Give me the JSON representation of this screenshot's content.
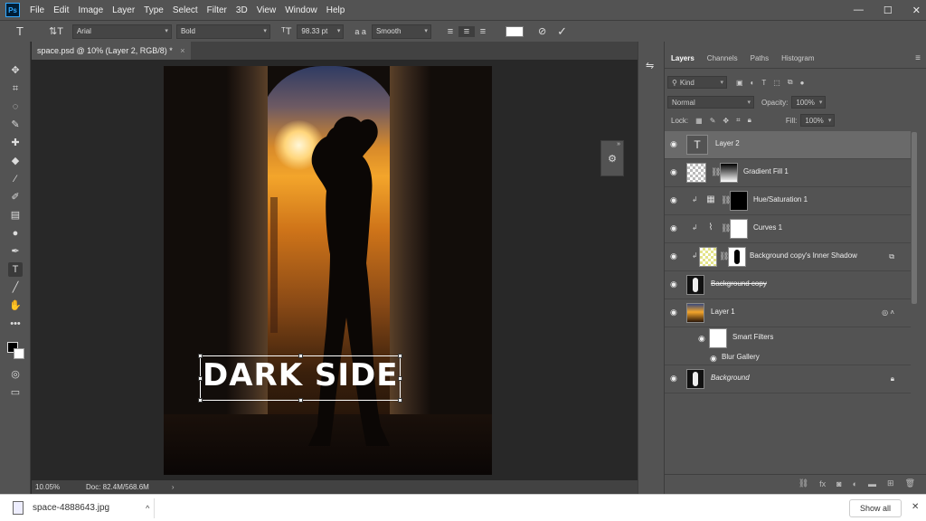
{
  "menubar": {
    "logo": "Ps",
    "items": [
      "File",
      "Edit",
      "Image",
      "Layer",
      "Type",
      "Select",
      "Filter",
      "3D",
      "View",
      "Window",
      "Help"
    ],
    "win_min": "—",
    "win_max": "☐",
    "win_close": "✕"
  },
  "options": {
    "font_family": "Arial",
    "font_style": "Bold",
    "font_size": "98.33 pt",
    "aa_label": "a a",
    "antialias": "Smooth",
    "text_color": "#ffffff"
  },
  "document": {
    "tab_title": "space.psd @ 10% (Layer 2, RGB/8) *",
    "tab_close": "×",
    "text_content": "DARK SIDE",
    "zoom": "10.05%",
    "doc_size": "Doc: 82.4M/568.6M"
  },
  "panel": {
    "tabs": [
      "Layers",
      "Channels",
      "Paths",
      "Histogram"
    ],
    "kind_placeholder": "Kind",
    "blend_mode": "Normal",
    "opacity_label": "Opacity:",
    "opacity_value": "100%",
    "lock_label": "Lock:",
    "fill_label": "Fill:",
    "fill_value": "100%"
  },
  "layers": [
    {
      "name": "Layer 2",
      "selected": true
    },
    {
      "name": "Gradient Fill 1"
    },
    {
      "name": "Hue/Saturation 1"
    },
    {
      "name": "Curves 1"
    },
    {
      "name": "Background copy's Inner Shadow"
    },
    {
      "name": "Background copy"
    },
    {
      "name": "Layer 1"
    },
    {
      "name": "Smart Filters"
    },
    {
      "name": "Blur Gallery"
    },
    {
      "name": "Background"
    }
  ],
  "downloads": {
    "filename": "space-4888643.jpg",
    "show_all": "Show all",
    "close": "✕",
    "caret": "^"
  }
}
